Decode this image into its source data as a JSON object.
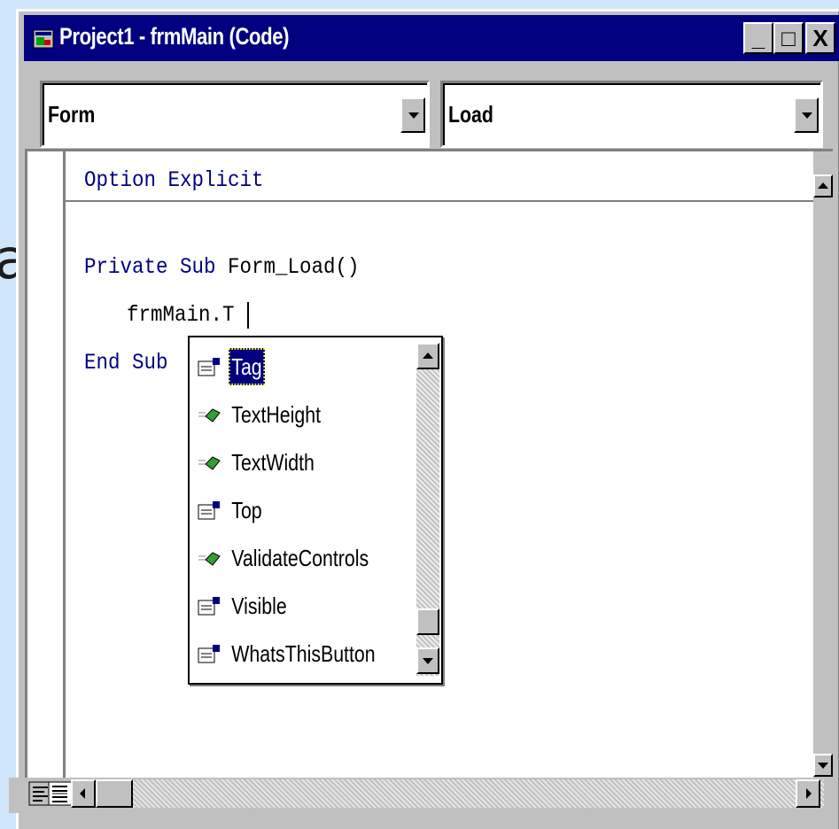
{
  "background_fragment": "a",
  "window": {
    "title": "Project1 - frmMain (Code)",
    "buttons": {
      "minimize": "_",
      "maximize": "□",
      "close": "X"
    }
  },
  "object_combo": {
    "value": "Form"
  },
  "procedure_combo": {
    "value": "Load"
  },
  "code": {
    "line1_kw": "Option Explicit",
    "line2_kw": "Private Sub",
    "line2_rest": " Form_Load()",
    "line3": "frmMain.T",
    "line4_kw": "End Sub"
  },
  "autocomplete": {
    "items": [
      {
        "label": "Tag",
        "icon": "property-icon",
        "selected": true
      },
      {
        "label": "TextHeight",
        "icon": "method-icon"
      },
      {
        "label": "TextWidth",
        "icon": "method-icon"
      },
      {
        "label": "Top",
        "icon": "property-icon"
      },
      {
        "label": "ValidateControls",
        "icon": "method-icon"
      },
      {
        "label": "Visible",
        "icon": "property-icon"
      },
      {
        "label": "WhatsThisButton",
        "icon": "property-icon"
      }
    ]
  },
  "colors": {
    "titlebar": "#000080",
    "keyword": "#000080",
    "selection": "#000080",
    "face": "#c0c0c0"
  }
}
